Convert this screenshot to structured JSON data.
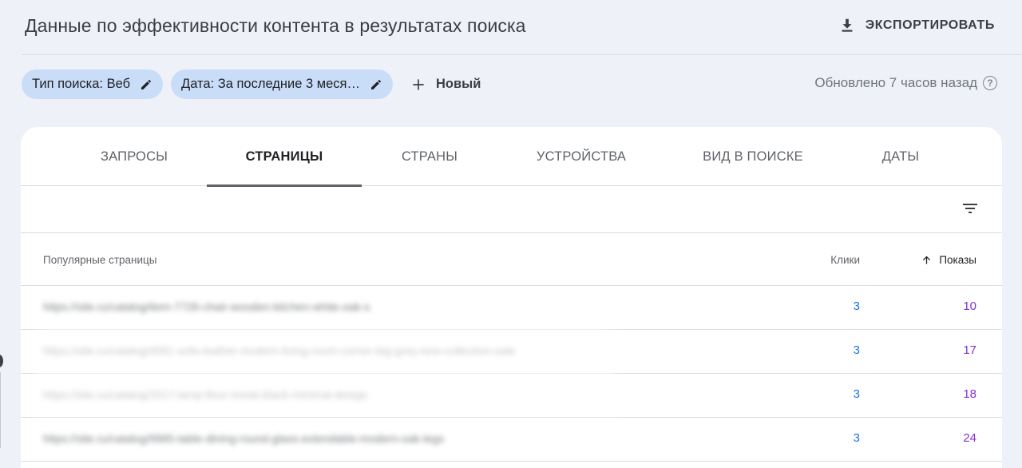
{
  "header": {
    "title": "Данные по эффективности контента в результатах поиска",
    "export_label": "ЭКСПОРТИРОВАТЬ"
  },
  "filters": {
    "chips": [
      {
        "label": "Тип поиска: Веб"
      },
      {
        "label": "Дата: За последние 3 меся…"
      }
    ],
    "new_label": "Новый",
    "updated_text": "Обновлено 7 часов назад"
  },
  "tabs": [
    {
      "label": "ЗАПРОСЫ",
      "active": false
    },
    {
      "label": "СТРАНИЦЫ",
      "active": true
    },
    {
      "label": "СТРАНЫ",
      "active": false
    },
    {
      "label": "УСТРОЙСТВА",
      "active": false
    },
    {
      "label": "ВИД В ПОИСКЕ",
      "active": false
    },
    {
      "label": "ДАТЫ",
      "active": false
    }
  ],
  "table": {
    "columns": {
      "pages": "Популярные страницы",
      "clicks": "Клики",
      "impressions": "Показы"
    },
    "rows": [
      {
        "url": "https://site.ru/catalog/item-7726-chair-wooden-kitchen-white-oak-s",
        "clicks": "3",
        "impressions": "10"
      },
      {
        "url": "https://site.ru/catalog/4561-sofa-leather-modern-living-room-corner-big-grey-new-collection-sale",
        "clicks": "3",
        "impressions": "17"
      },
      {
        "url": "https://site.ru/catalog/3317-lamp-floor-metal-black-minimal-design",
        "clicks": "3",
        "impressions": "18"
      },
      {
        "url": "https://site.ru/catalog/9985-table-dining-round-glass-extendable-modern-oak-legs",
        "clicks": "3",
        "impressions": "24"
      }
    ]
  },
  "colors": {
    "accent_blue": "#1a73e8",
    "accent_purple": "#8430ce",
    "chip_bg": "#c9ddf8",
    "page_bg": "#eef2f8"
  },
  "icons": {
    "export": "download-icon",
    "edit": "pencil-icon",
    "add": "plus-icon",
    "help": "help-circle-icon",
    "filter": "filter-icon",
    "sort": "arrow-up-icon"
  }
}
